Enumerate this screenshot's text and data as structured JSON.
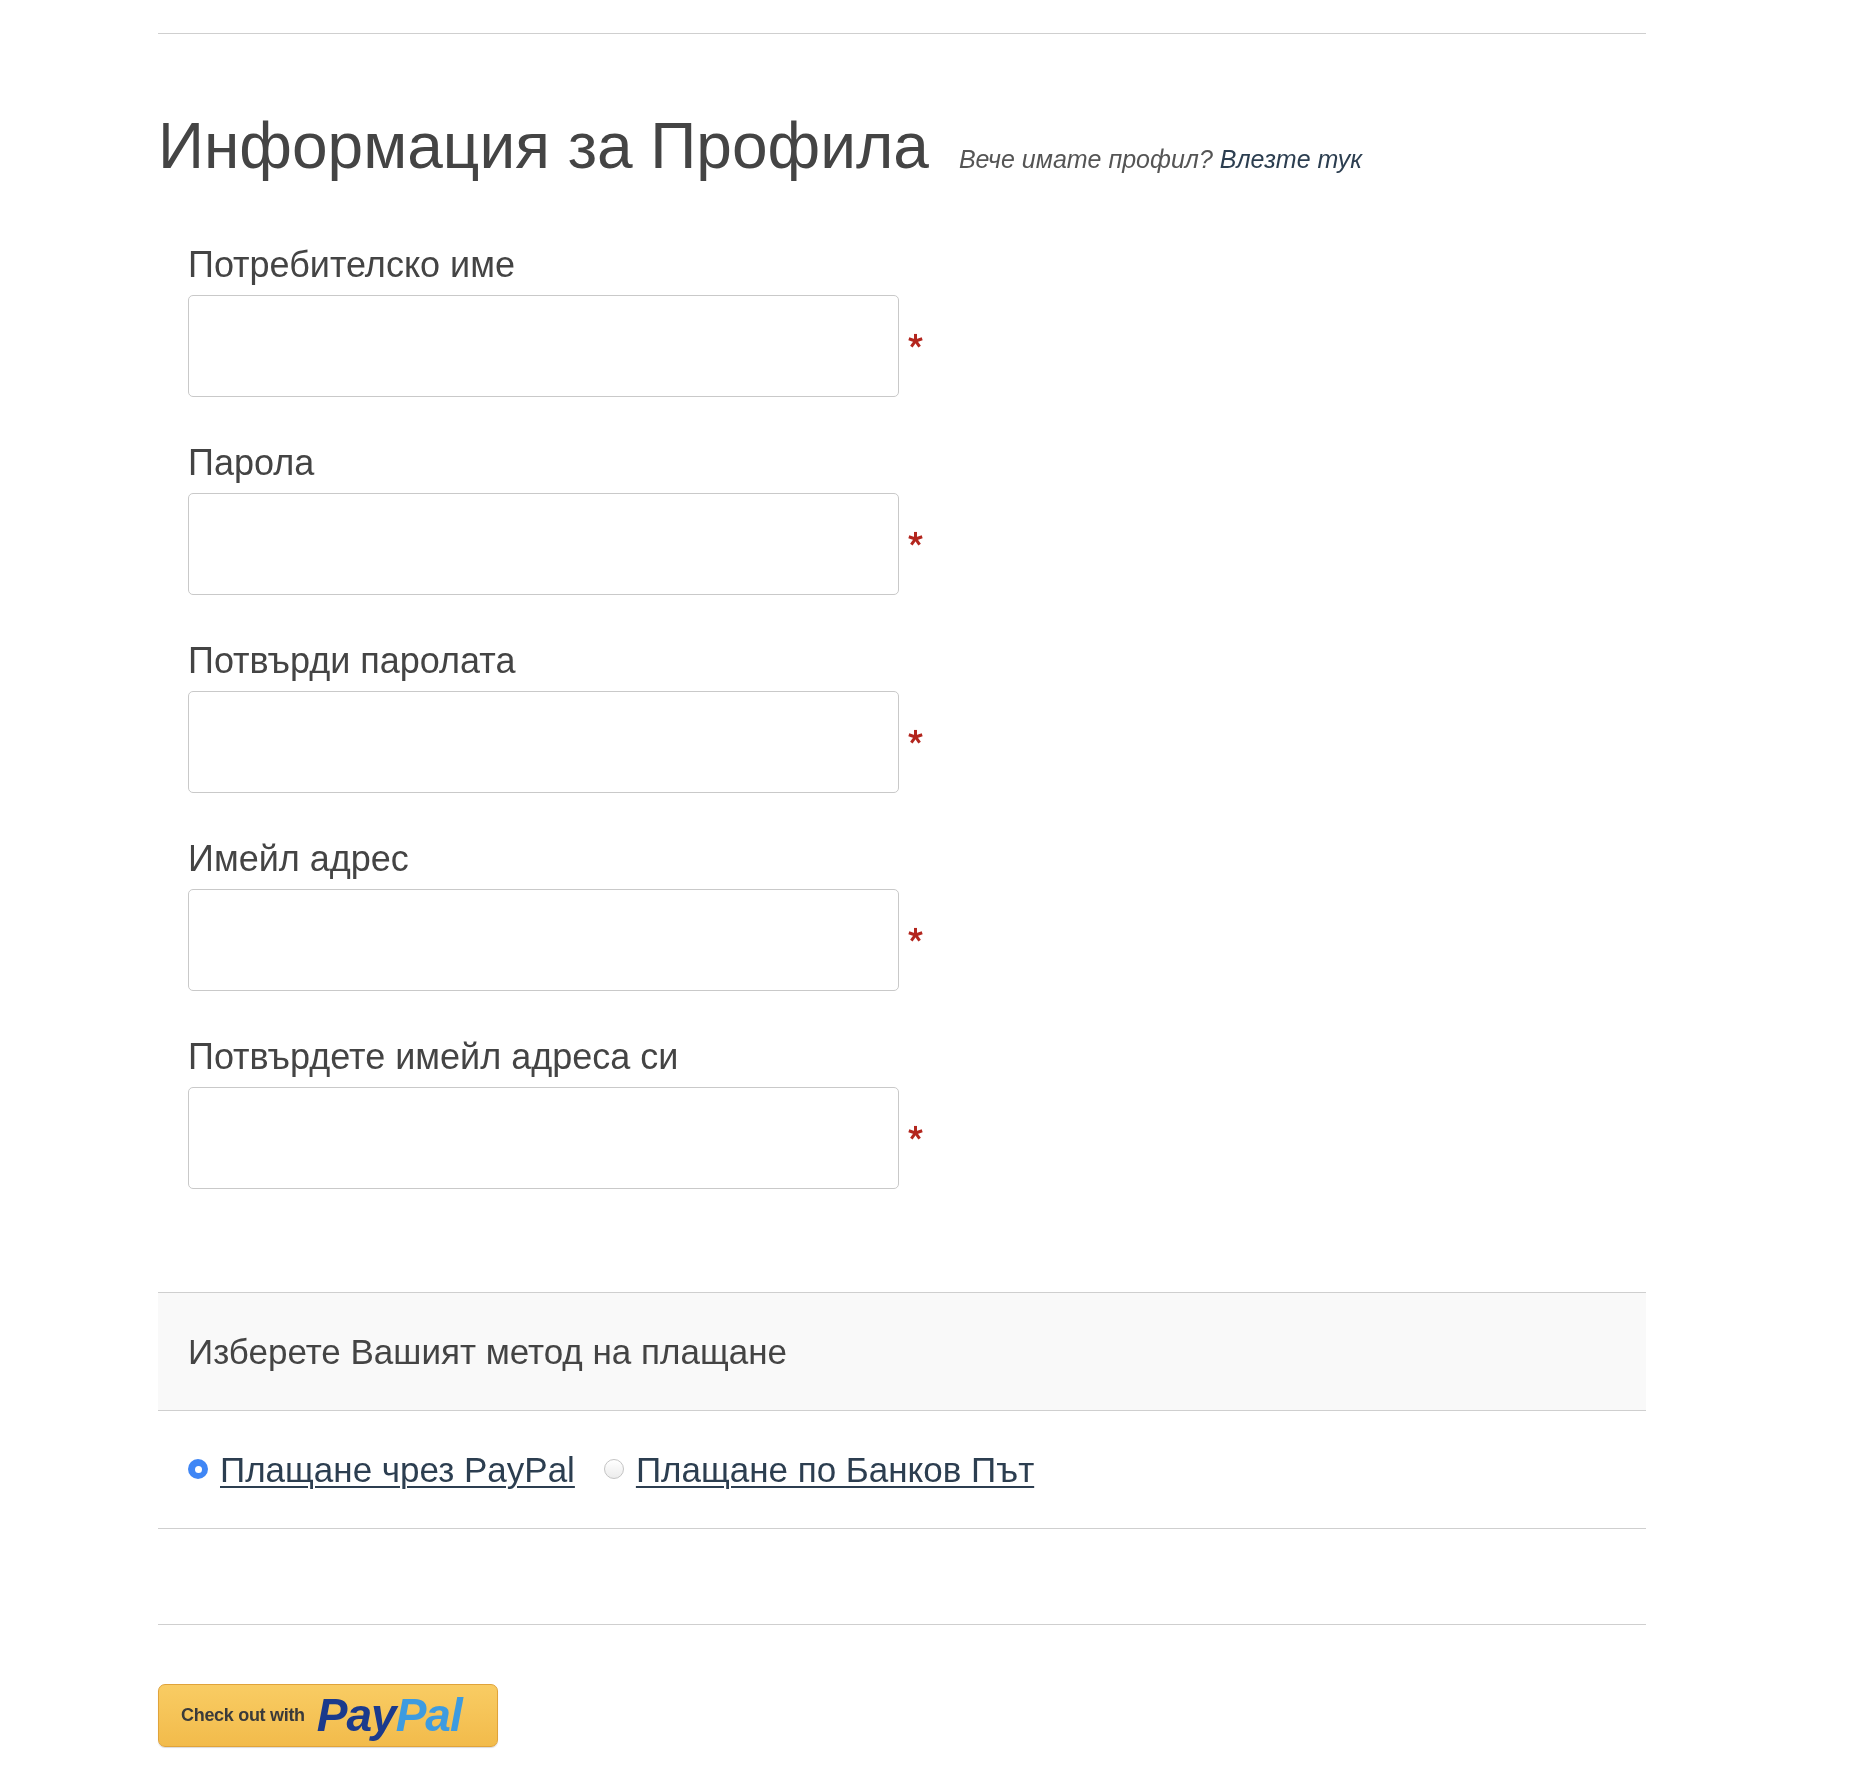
{
  "header": {
    "title": "Информация за Профила",
    "note": "Вече имате профил?",
    "login_link": "Влезте тук"
  },
  "fields": [
    {
      "label": "Потребителско име",
      "required": true
    },
    {
      "label": "Парола",
      "required": true
    },
    {
      "label": "Потвърди паролата",
      "required": true
    },
    {
      "label": "Имейл адрес",
      "required": true
    },
    {
      "label": "Потвърдете имейл адреса си",
      "required": true
    }
  ],
  "payment": {
    "title": "Изберете Вашият метод на плащане",
    "options": [
      {
        "label": "Плащане чрез PayPal",
        "selected": true
      },
      {
        "label": "Плащане по Банков Път",
        "selected": false
      }
    ]
  },
  "checkout_button": {
    "label": "Check out with",
    "logo": [
      "Pay",
      "Pal"
    ]
  }
}
